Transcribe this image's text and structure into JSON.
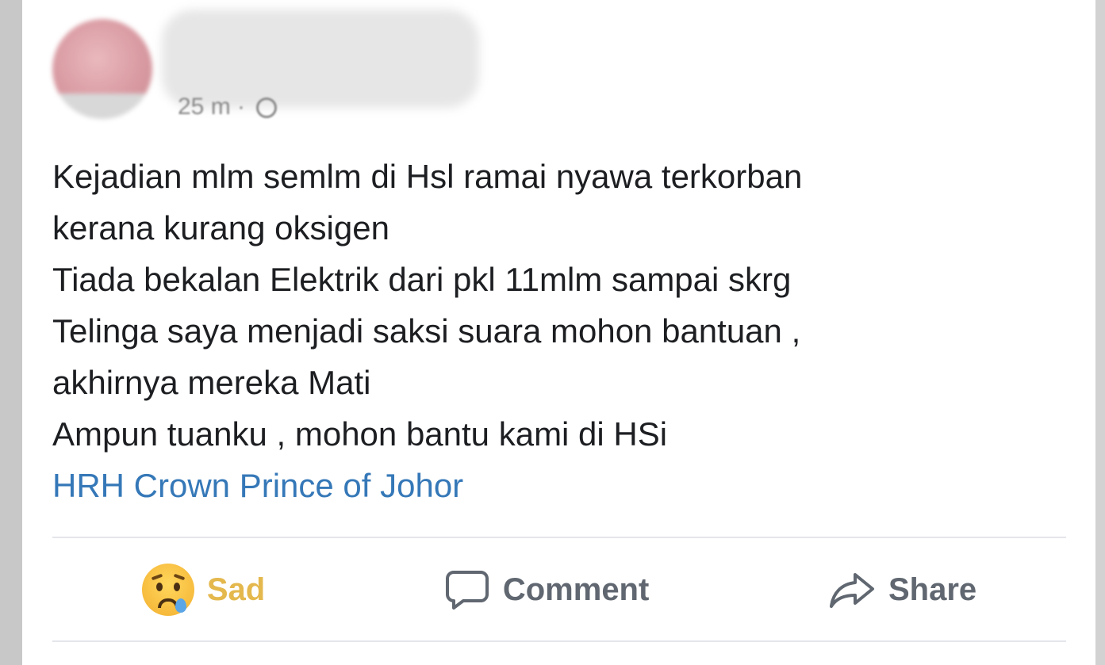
{
  "post": {
    "timestamp": "25 m",
    "separator": "·",
    "body_lines": [
      "Kejadian mlm semlm di Hsl ramai nyawa terkorban",
      "kerana kurang oksigen",
      "Tiada bekalan Elektrik dari pkl 11mlm sampai skrg",
      "Telinga saya menjadi saksi suara mohon bantuan ,",
      "akhirnya mereka Mati",
      "Ampun tuanku , mohon bantu kami di HSi"
    ],
    "mention": "HRH Crown Prince of Johor"
  },
  "actions": {
    "reaction_label": "Sad",
    "comment_label": "Comment",
    "share_label": "Share"
  },
  "icons": {
    "reaction": "sad-face-icon",
    "comment": "comment-icon",
    "share": "share-icon",
    "privacy": "globe-icon"
  },
  "colors": {
    "text": "#1c1e21",
    "mention": "#3578b8",
    "muted": "#606770",
    "sad": "#e4b84d"
  }
}
